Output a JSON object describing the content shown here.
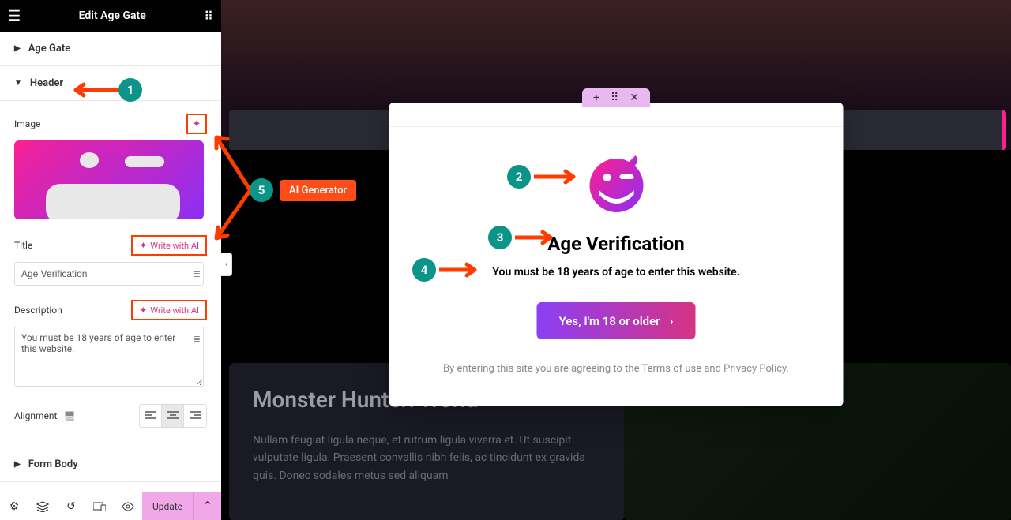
{
  "panel": {
    "title": "Edit Age Gate",
    "sections": {
      "age_gate": "Age Gate",
      "header": "Header",
      "form_body": "Form Body"
    },
    "image_label": "Image",
    "title_label": "Title",
    "title_value": "Age Verification",
    "write_ai": "Write with AI",
    "description_label": "Description",
    "description_value": "You must be 18 years of age to enter this website.",
    "alignment_label": "Alignment",
    "update_label": "Update"
  },
  "modal": {
    "title": "Age Verification",
    "description": "You must be 18 years of age to enter this website.",
    "button_label": "Yes, I'm 18 or older",
    "footer": "By entering this site you are agreeing to the Terms of use and Privacy Policy."
  },
  "article": {
    "title": "Monster Hunter: World",
    "body": "Nullam feugiat ligula neque, et rutrum ligula viverra et. Ut suscipit vulputate ligula. Praesent convallis nibh felis, ac tincidunt ex gravida quis. Donec sodales metus sed aliquam"
  },
  "annotations": {
    "ai_generator": "AI Generator",
    "badges": {
      "1": "1",
      "2": "2",
      "3": "3",
      "4": "4",
      "5": "5"
    }
  }
}
